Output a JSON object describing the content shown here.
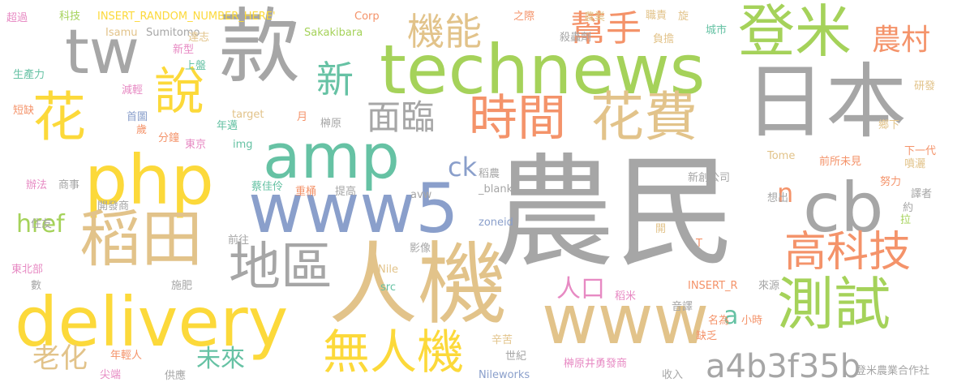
{
  "palette": {
    "gray": "#a6a6a6",
    "tan": "#e2c38a",
    "green": "#a5d25a",
    "yellow": "#fcd93a",
    "orange": "#f4936a",
    "teal": "#66c2a4",
    "blue": "#8a9fcb",
    "pink": "#e78ac3",
    "background": "#ffffff"
  },
  "words": [
    "農民",
    "人機",
    "款",
    "technews",
    "日本",
    "登米",
    "delivery",
    "php",
    "www5",
    "amp",
    "花費",
    "時間",
    "稻田",
    "測試",
    "www",
    "cb",
    "tw",
    "說",
    "花",
    "高科技",
    "地區",
    "無人機",
    "機能",
    "幫手",
    "農村",
    "面臨",
    "新",
    "a4b3f35b",
    "老化",
    "未來",
    "人口",
    "href",
    "ck",
    "n",
    "a",
    "超過",
    "科技",
    "INSERT_RANDOM_NUMBER_HERE'",
    "Corp",
    "之際",
    "農業",
    "職責",
    "旋",
    "Isamu",
    "Sumitomo",
    "達志",
    "Sakakibara",
    "殺蟲劑",
    "負擔",
    "城市",
    "新型",
    "上盤",
    "生產力",
    "減輕",
    "研發",
    "短缺",
    "首圖",
    "歲",
    "分鐘",
    "年邁",
    "target",
    "月",
    "榊原",
    "東京",
    "img",
    "鄉下",
    "Tome",
    "前所未見",
    "下一代",
    "噴灑",
    "稻農",
    "努力",
    "辦法",
    "商事",
    "開發商",
    "蔡佳伶",
    "重桶",
    "提高",
    "avw",
    "_blank'",
    "新創公司",
    "想出",
    "譯者",
    "約",
    "住友",
    "拉",
    "前往",
    "zoneid",
    "影像",
    "開",
    "T",
    "東北部",
    "數",
    "施肥",
    "Nile",
    "INSERT_R",
    "來源",
    "src",
    "稻米",
    "音譯",
    "辛苦",
    "名為",
    "小時",
    "年輕人",
    "世紀",
    "缺乏",
    "尖端",
    "供應",
    "Nileworks",
    "榊原井勇發商",
    "收入",
    "登米農業合作社"
  ]
}
